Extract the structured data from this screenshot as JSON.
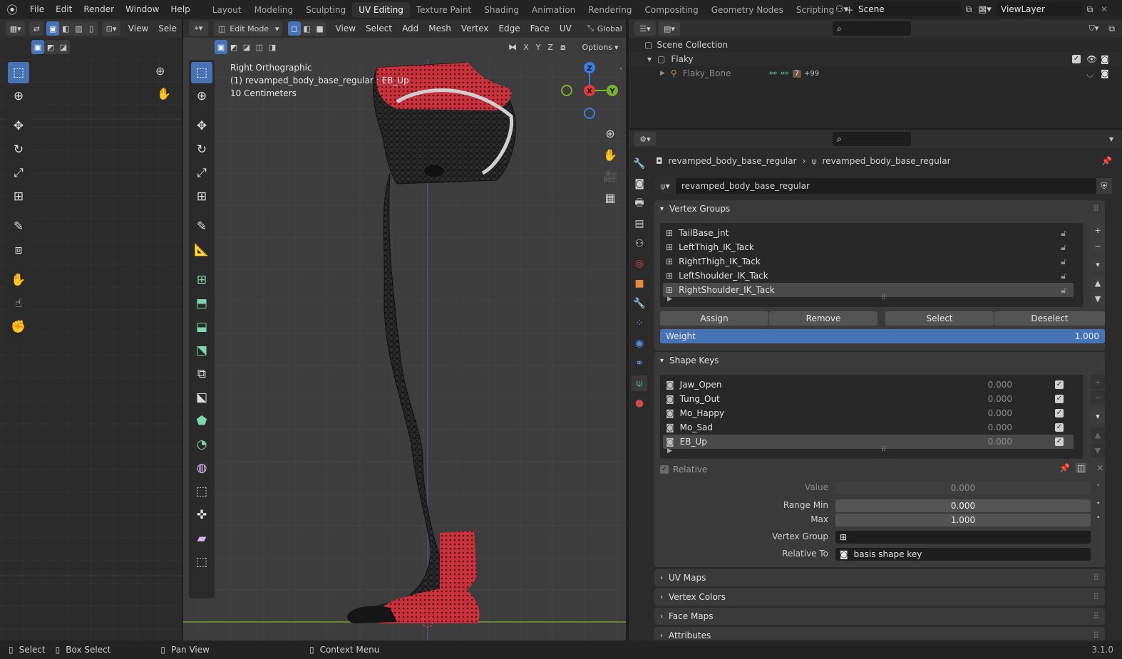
{
  "menu": {
    "file": "File",
    "edit": "Edit",
    "render": "Render",
    "window": "Window",
    "help": "Help"
  },
  "workspaces": [
    "Layout",
    "Modeling",
    "Sculpting",
    "UV Editing",
    "Texture Paint",
    "Shading",
    "Animation",
    "Rendering",
    "Compositing",
    "Geometry Nodes",
    "Scripting"
  ],
  "active_workspace": "UV Editing",
  "scene": {
    "name": "Scene",
    "view_layer": "ViewLayer"
  },
  "uv_editor": {
    "view": "View",
    "select": "Sele"
  },
  "viewport": {
    "mode": "Edit Mode",
    "menus": [
      "View",
      "Select",
      "Add",
      "Mesh",
      "Vertex",
      "Edge",
      "Face",
      "UV"
    ],
    "orientation": "Global",
    "options": "Options",
    "axes": [
      "X",
      "Y",
      "Z"
    ],
    "overlay_title": "Right Orthographic",
    "overlay_object": "(1) revamped_body_base_regular : EB_Up",
    "overlay_scale": "10 Centimeters",
    "gizmo": {
      "z": "Z",
      "y": "Y",
      "x": "X"
    }
  },
  "outliner": {
    "root": "Scene Collection",
    "collection": "Flaky",
    "child": "Flaky_Bone",
    "child_badge_count": "7",
    "child_more": "+99"
  },
  "properties": {
    "breadcrumb_object": "revamped_body_base_regular",
    "breadcrumb_data": "revamped_body_base_regular",
    "data_name": "revamped_body_base_regular",
    "vertex_groups": {
      "title": "Vertex Groups",
      "items": [
        "TailBase_jnt",
        "LeftThigh_IK_Tack",
        "RightThigh_IK_Tack",
        "LeftShoulder_IK_Tack",
        "RightShoulder_IK_Tack"
      ],
      "selected_index": 4,
      "assign": "Assign",
      "remove": "Remove",
      "select": "Select",
      "deselect": "Deselect",
      "weight_label": "Weight",
      "weight_value": "1.000"
    },
    "shape_keys": {
      "title": "Shape Keys",
      "items": [
        {
          "name": "Jaw_Open",
          "value": "0.000"
        },
        {
          "name": "Tung_Out",
          "value": "0.000"
        },
        {
          "name": "Mo_Happy",
          "value": "0.000"
        },
        {
          "name": "Mo_Sad",
          "value": "0.000"
        },
        {
          "name": "EB_Up",
          "value": "0.000"
        }
      ],
      "selected_index": 4,
      "relative": "Relative",
      "value_label": "Value",
      "value": "0.000",
      "range_min_label": "Range Min",
      "range_min": "0.000",
      "max_label": "Max",
      "max": "1.000",
      "vertex_group_label": "Vertex Group",
      "vertex_group": "",
      "relative_to_label": "Relative To",
      "relative_to": "basis shape key"
    },
    "collapsed_panels": [
      "UV Maps",
      "Vertex Colors",
      "Face Maps",
      "Attributes"
    ]
  },
  "status": {
    "select": "Select",
    "box_select": "Box Select",
    "pan_view": "Pan View",
    "context_menu": "Context Menu",
    "version": "3.1.0"
  },
  "colors": {
    "accent": "#4772b3",
    "mesh_red": "#c8323c",
    "x_axis": "#e0383d",
    "y_axis": "#7ab132",
    "z_axis": "#3b7ce0"
  }
}
